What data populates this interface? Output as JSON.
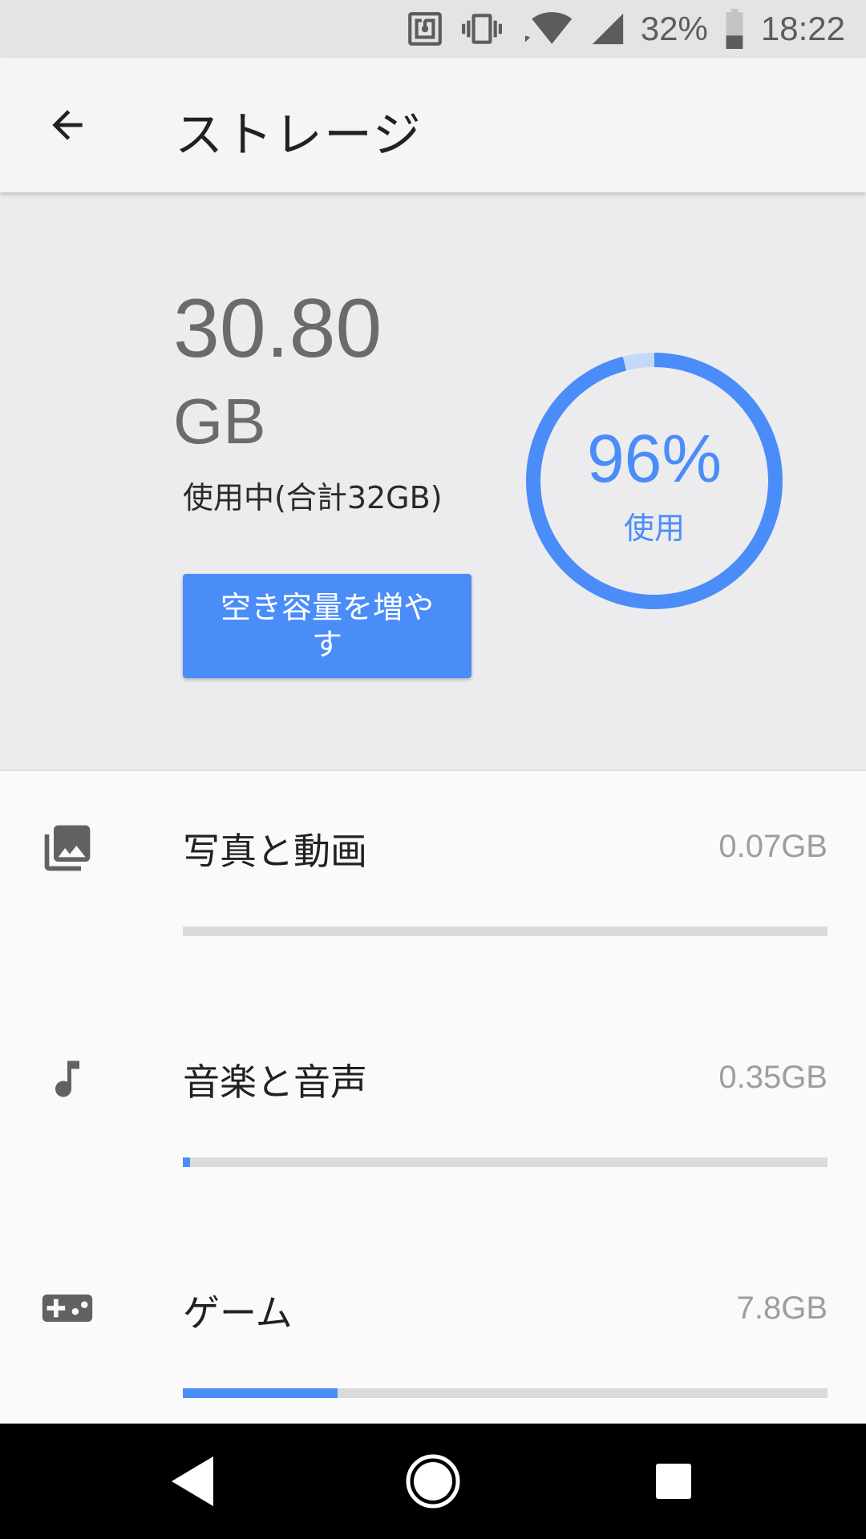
{
  "status_bar": {
    "battery_text": "32%",
    "time": "18:22",
    "icons": [
      "nfc-icon",
      "vibrate-icon",
      "wifi-icon",
      "signal-icon",
      "battery-icon"
    ]
  },
  "app_bar": {
    "title": "ストレージ",
    "back_icon": "arrow-back-icon"
  },
  "summary": {
    "used_value": "30.80",
    "used_unit": "GB",
    "used_caption": "使用中(合計32GB)",
    "free_button_label": "空き容量を増やす",
    "ring_percent_text": "96%",
    "ring_label": "使用",
    "ring_fraction": 0.96,
    "accent_color": "#4a8df8"
  },
  "categories": [
    {
      "icon": "photo-library-icon",
      "label": "写真と動画",
      "size": "0.07GB",
      "fraction": 0.0
    },
    {
      "icon": "music-note-icon",
      "label": "音楽と音声",
      "size": "0.35GB",
      "fraction": 0.011
    },
    {
      "icon": "gamepad-icon",
      "label": "ゲーム",
      "size": "7.8GB",
      "fraction": 0.24
    }
  ],
  "nav_bar": {
    "icons": [
      "nav-back-icon",
      "nav-home-icon",
      "nav-recents-icon"
    ]
  }
}
